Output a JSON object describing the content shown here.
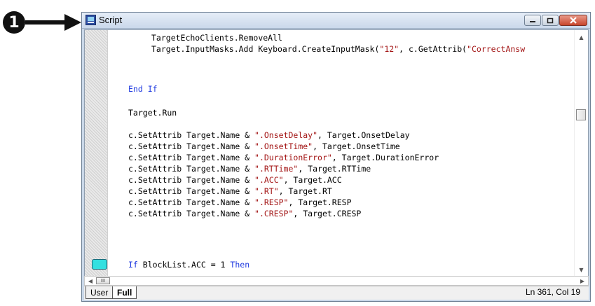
{
  "callout": {
    "number": "1"
  },
  "window": {
    "title": "Script",
    "buttons": {
      "minimize": "minimize",
      "maximize": "maximize",
      "close": "close"
    }
  },
  "editor": {
    "lines": [
      [
        {
          "t": "TargetEchoClients.RemoveAll",
          "c": ""
        }
      ],
      [
        {
          "t": "Target.InputMasks.Add Keyboard.CreateInputMask(",
          "c": ""
        },
        {
          "t": "\"12\"",
          "c": "str"
        },
        {
          "t": ", c.GetAttrib(",
          "c": ""
        },
        {
          "t": "\"CorrectAnsw",
          "c": "str"
        }
      ],
      [
        {
          "t": "End If",
          "c": "kw"
        }
      ],
      [
        {
          "t": "Target.Run",
          "c": ""
        }
      ],
      [
        {
          "t": "c.SetAttrib Target.Name & ",
          "c": ""
        },
        {
          "t": "\".OnsetDelay\"",
          "c": "str"
        },
        {
          "t": ", Target.OnsetDelay",
          "c": ""
        }
      ],
      [
        {
          "t": "c.SetAttrib Target.Name & ",
          "c": ""
        },
        {
          "t": "\".OnsetTime\"",
          "c": "str"
        },
        {
          "t": ", Target.OnsetTime",
          "c": ""
        }
      ],
      [
        {
          "t": "c.SetAttrib Target.Name & ",
          "c": ""
        },
        {
          "t": "\".DurationError\"",
          "c": "str"
        },
        {
          "t": ", Target.DurationError",
          "c": ""
        }
      ],
      [
        {
          "t": "c.SetAttrib Target.Name & ",
          "c": ""
        },
        {
          "t": "\".RTTime\"",
          "c": "str"
        },
        {
          "t": ", Target.RTTime",
          "c": ""
        }
      ],
      [
        {
          "t": "c.SetAttrib Target.Name & ",
          "c": ""
        },
        {
          "t": "\".ACC\"",
          "c": "str"
        },
        {
          "t": ", Target.ACC",
          "c": ""
        }
      ],
      [
        {
          "t": "c.SetAttrib Target.Name & ",
          "c": ""
        },
        {
          "t": "\".RT\"",
          "c": "str"
        },
        {
          "t": ", Target.RT",
          "c": ""
        }
      ],
      [
        {
          "t": "c.SetAttrib Target.Name & ",
          "c": ""
        },
        {
          "t": "\".RESP\"",
          "c": "str"
        },
        {
          "t": ", Target.RESP",
          "c": ""
        }
      ],
      [
        {
          "t": "c.SetAttrib Target.Name & ",
          "c": ""
        },
        {
          "t": "\".CRESP\"",
          "c": "str"
        },
        {
          "t": ", Target.CRESP",
          "c": ""
        }
      ],
      [
        {
          "t": "If",
          "c": "kw"
        },
        {
          "t": " BlockList.ACC = 1 ",
          "c": ""
        },
        {
          "t": "Then",
          "c": "kw"
        }
      ]
    ],
    "colors": {
      "keyword": "#1f3ae0",
      "string": "#a31515",
      "bookmark": "#33e0e0"
    }
  },
  "hscroll": {
    "thumb_label": "III"
  },
  "tabs": {
    "user": "User",
    "full": "Full"
  },
  "status": {
    "position": "Ln 361, Col 19"
  }
}
